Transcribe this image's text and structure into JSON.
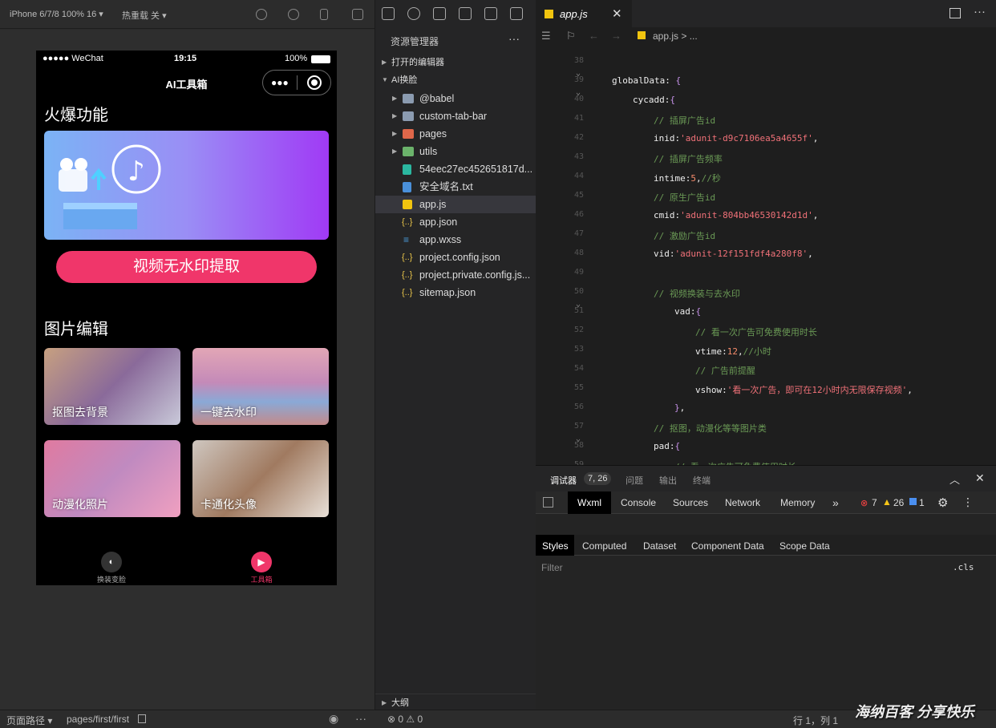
{
  "topbar": {
    "device": "iPhone 6/7/8 100% 16 ▾",
    "reload": "热重载 关 ▾"
  },
  "phone": {
    "carrier": "●●●●● WeChat",
    "time": "19:15",
    "battery": "100%",
    "title": "AI工具箱",
    "section1": "火爆功能",
    "main_button": "视频无水印提取",
    "section2": "图片编辑",
    "cards": [
      {
        "label": "抠图去背景"
      },
      {
        "label": "一键去水印"
      },
      {
        "label": "动漫化照片"
      },
      {
        "label": "卡通化头像"
      }
    ],
    "tabs": [
      {
        "label": "换装变脸"
      },
      {
        "label": "工具箱"
      }
    ]
  },
  "explorer": {
    "title": "资源管理器",
    "open_editors": "打开的编辑器",
    "project": "AI换脸",
    "items": [
      {
        "name": "@babel",
        "icon": "folder-icon"
      },
      {
        "name": "custom-tab-bar",
        "icon": "folder-icon"
      },
      {
        "name": "pages",
        "icon": "folder-icon"
      },
      {
        "name": "utils",
        "icon": "folder-icon"
      },
      {
        "name": "54eec27ec452651817d...",
        "icon": "file-icon"
      },
      {
        "name": "安全域名.txt",
        "icon": "file-icon"
      },
      {
        "name": "app.js",
        "icon": "js-icon"
      },
      {
        "name": "app.json",
        "icon": "json-icon"
      },
      {
        "name": "app.wxss",
        "icon": "css-icon"
      },
      {
        "name": "project.config.json",
        "icon": "json-icon"
      },
      {
        "name": "project.private.config.js...",
        "icon": "json-icon"
      },
      {
        "name": "sitemap.json",
        "icon": "json-icon"
      }
    ],
    "outline": "大纲",
    "status": "⊗ 0 ⚠ 0"
  },
  "editor": {
    "tab": "app.js",
    "breadcrumb": "app.js > ...",
    "lines": [
      {
        "n": "38",
        "text": ""
      },
      {
        "n": "39",
        "text": "globalData: {"
      },
      {
        "n": "40",
        "text": "cycadd:{"
      },
      {
        "n": "41",
        "text": "// 插屏广告id"
      },
      {
        "n": "42",
        "text": "inid:'adunit-d9c7106ea5a4655f',"
      },
      {
        "n": "43",
        "text": "// 插屏广告频率"
      },
      {
        "n": "44",
        "text": "intime:5,//秒"
      },
      {
        "n": "45",
        "text": "// 原生广告id"
      },
      {
        "n": "46",
        "text": "cmid:'adunit-804bb46530142d1d',"
      },
      {
        "n": "47",
        "text": "// 激励广告id"
      },
      {
        "n": "48",
        "text": "vid:'adunit-12f151fdf4a280f8',"
      },
      {
        "n": "49",
        "text": ""
      },
      {
        "n": "50",
        "text": "// 视频换装与去水印"
      },
      {
        "n": "51",
        "text": "vad:{"
      },
      {
        "n": "52",
        "text": "// 看一次广告可免费使用时长"
      },
      {
        "n": "53",
        "text": "vtime:12,//小时"
      },
      {
        "n": "54",
        "text": "// 广告前提醒"
      },
      {
        "n": "55",
        "text": "vshow:'看一次广告，即可在12小时内无限保存视频',"
      },
      {
        "n": "56",
        "text": "},"
      },
      {
        "n": "57",
        "text": "// 抠图，动漫化等等图片类"
      },
      {
        "n": "58",
        "text": "pad:{"
      },
      {
        "n": "59",
        "text": "// 看一次广告可免费使用时长"
      }
    ]
  },
  "devtools": {
    "top_tabs": [
      "调试器",
      "7, 26",
      "问题",
      "输出",
      "终端"
    ],
    "tabs": [
      "Wxml",
      "Console",
      "Sources",
      "Network",
      "Memory"
    ],
    "errors": "7",
    "warnings": "26",
    "infos": "1",
    "sub_tabs": [
      "Styles",
      "Computed",
      "Dataset",
      "Component Data",
      "Scope Data"
    ],
    "filter": "Filter",
    "cls": ".cls"
  },
  "bottombar": {
    "path_label": "页面路径 ▾",
    "path": "pages/first/first",
    "position": "行 1，列 1",
    "watermark": "海纳百客 分享快乐"
  }
}
